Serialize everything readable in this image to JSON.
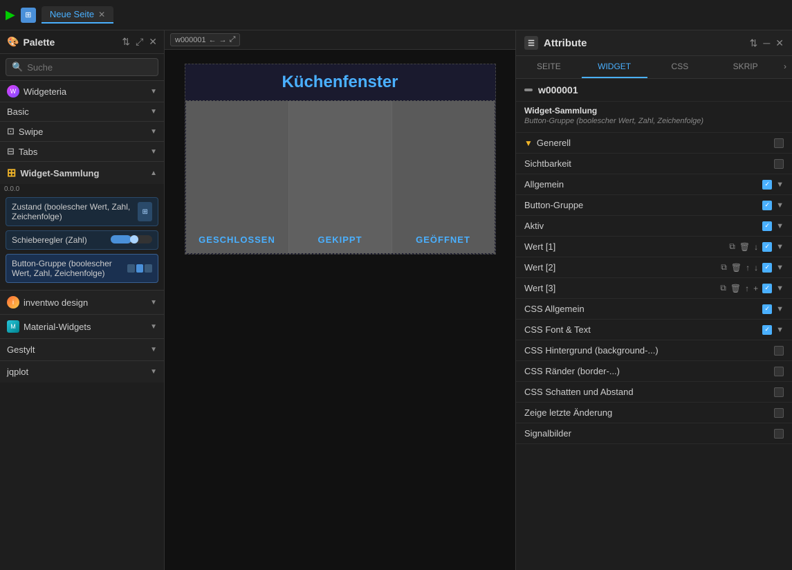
{
  "topbar": {
    "tab_label": "Neue Seite",
    "play_icon": "▶"
  },
  "sidebar": {
    "title": "Palette",
    "search_placeholder": "Suche",
    "sections": [
      {
        "label": "Widgeteria",
        "has_icon": true
      },
      {
        "label": "Basic",
        "has_icon": false
      },
      {
        "label": "Swipe",
        "has_icon": true
      },
      {
        "label": "Tabs",
        "has_icon": true
      }
    ],
    "widget_sammlung": {
      "label": "Widget-Sammlung",
      "version": "0.0.0",
      "items": [
        {
          "label": "Zustand (boolescher Wert, Zahl, Zeichenfolge)",
          "type": "state"
        },
        {
          "label": "Schieberegler (Zahl)",
          "type": "slider"
        },
        {
          "label": "Button-Gruppe (boolescher Wert, Zahl, Zeichenfolge)",
          "type": "button-group"
        }
      ]
    },
    "bottom_sections": [
      {
        "label": "inventwo design"
      },
      {
        "label": "Material-Widgets"
      },
      {
        "label": "Gestylt"
      },
      {
        "label": "jqplot"
      }
    ]
  },
  "canvas": {
    "widget_id": "w000001",
    "page_title": "Küchenfenster",
    "button_options": [
      {
        "label": "GESCHLOSSEN",
        "state": "closed"
      },
      {
        "label": "GEKIPPT",
        "state": "gekippt"
      },
      {
        "label": "GEÖFFNET",
        "state": "geoeffnet"
      }
    ]
  },
  "right_panel": {
    "title": "Attribute",
    "tabs": [
      {
        "label": "SEITE"
      },
      {
        "label": "WIDGET",
        "active": true
      },
      {
        "label": "CSS"
      },
      {
        "label": "SKRIP"
      }
    ],
    "widget_id": "w000001",
    "widget_sammlung_title": "Widget-Sammlung",
    "widget_sammlung_sub": "Button-Gruppe (boolescher Wert, Zahl, Zeichenfolge)",
    "attributes": [
      {
        "label": "Generell",
        "has_filter": true,
        "checked": false,
        "expandable": true,
        "expanded": false
      },
      {
        "label": "Sichtbarkeit",
        "has_filter": false,
        "checked": false,
        "expandable": false
      },
      {
        "label": "Allgemein",
        "has_filter": false,
        "checked": true,
        "expandable": true,
        "expanded": true
      },
      {
        "label": "Button-Gruppe",
        "has_filter": false,
        "checked": true,
        "expandable": true,
        "expanded": true
      },
      {
        "label": "Aktiv",
        "has_filter": false,
        "checked": true,
        "expandable": true,
        "expanded": true
      },
      {
        "label": "Wert [1]",
        "has_filter": false,
        "checked": true,
        "expandable": true,
        "expanded": false,
        "actions": [
          "copy",
          "delete",
          "down"
        ]
      },
      {
        "label": "Wert [2]",
        "has_filter": false,
        "checked": true,
        "expandable": true,
        "expanded": false,
        "actions": [
          "copy",
          "delete",
          "up",
          "down"
        ]
      },
      {
        "label": "Wert [3]",
        "has_filter": false,
        "checked": true,
        "expandable": true,
        "expanded": false,
        "actions": [
          "copy",
          "delete",
          "up",
          "add"
        ]
      },
      {
        "label": "CSS Allgemein",
        "has_filter": false,
        "checked": true,
        "expandable": true,
        "expanded": true
      },
      {
        "label": "CSS Font & Text",
        "has_filter": false,
        "checked": true,
        "expandable": true,
        "expanded": true
      },
      {
        "label": "CSS Hintergrund (background-...)",
        "has_filter": false,
        "checked": false,
        "expandable": false
      },
      {
        "label": "CSS Ränder (border-...)",
        "has_filter": false,
        "checked": false,
        "expandable": false
      },
      {
        "label": "CSS Schatten und Abstand",
        "has_filter": false,
        "checked": false,
        "expandable": false
      },
      {
        "label": "Zeige letzte Änderung",
        "has_filter": false,
        "checked": false,
        "expandable": false
      },
      {
        "label": "Signalbilder",
        "has_filter": false,
        "checked": false,
        "expandable": false
      }
    ]
  }
}
